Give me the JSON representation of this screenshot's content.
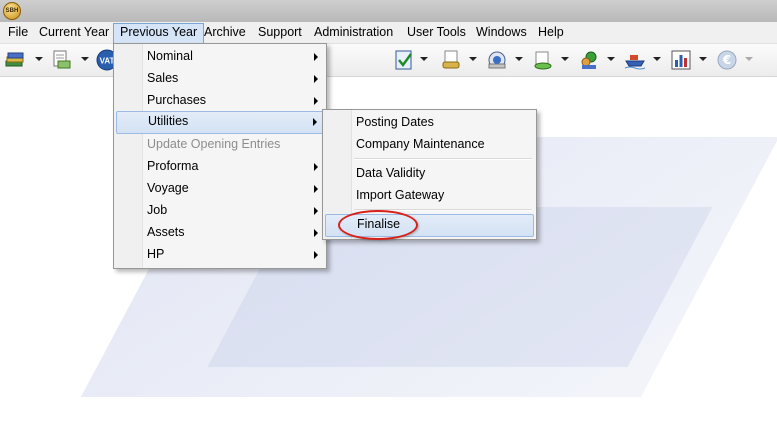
{
  "app": {
    "icon": "sbh-app-icon",
    "icon_text": "SBH"
  },
  "menubar": {
    "items": [
      "File",
      "Current Year",
      "Previous Year",
      "Archive",
      "Support",
      "Administration",
      "User Tools",
      "Windows",
      "Help"
    ],
    "active": "Previous Year"
  },
  "toolbar": {
    "icons": [
      "ledger-stack-icon",
      "document-money-icon",
      "vat-icon",
      "checklist-icon",
      "document-stack-icon",
      "currency-disc-icon",
      "coins-stack-icon",
      "globe-user-icon",
      "ship-icon",
      "bar-chart-icon",
      "euro-icon"
    ]
  },
  "previous_year_menu": {
    "items": [
      {
        "label": "Nominal",
        "submenu": true,
        "enabled": true
      },
      {
        "label": "Sales",
        "submenu": true,
        "enabled": true
      },
      {
        "label": "Purchases",
        "submenu": true,
        "enabled": true
      },
      {
        "label": "Utilities",
        "submenu": true,
        "enabled": true,
        "highlighted": true
      },
      {
        "label": "Update Opening Entries",
        "submenu": false,
        "enabled": false
      },
      {
        "label": "Proforma",
        "submenu": true,
        "enabled": true
      },
      {
        "label": "Voyage",
        "submenu": true,
        "enabled": true
      },
      {
        "label": "Job",
        "submenu": true,
        "enabled": true
      },
      {
        "label": "Assets",
        "submenu": true,
        "enabled": true
      },
      {
        "label": "HP",
        "submenu": true,
        "enabled": true
      }
    ]
  },
  "utilities_menu": {
    "items": [
      {
        "label": "Posting Dates"
      },
      {
        "label": "Company Maintenance"
      },
      {
        "label": "Data Validity"
      },
      {
        "label": "Import Gateway"
      },
      {
        "label": "Finalise",
        "highlighted": true,
        "annotated": true
      }
    ]
  },
  "annotation": {
    "color": "#d8201b",
    "target": "Finalise"
  }
}
